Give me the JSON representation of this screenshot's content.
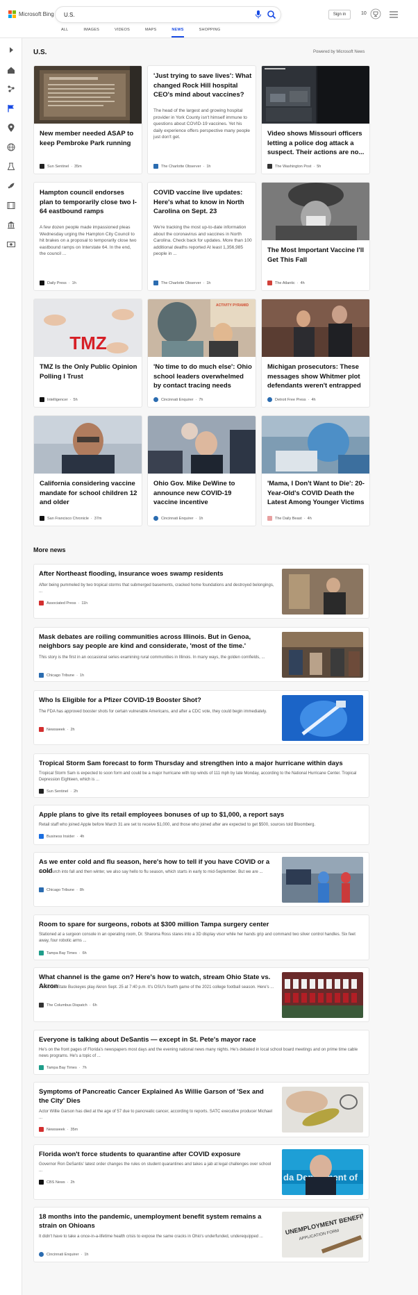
{
  "header": {
    "brand": "Microsoft Bing",
    "search_value": "U.S.",
    "sign_in": "Sign in",
    "rewards_count": "10",
    "tabs": [
      "ALL",
      "IMAGES",
      "VIDEOS",
      "MAPS",
      "NEWS",
      "SHOPPING"
    ],
    "active_tab": "NEWS"
  },
  "colors": {
    "accent": "#174ae4",
    "ms_red": "#f25022",
    "ms_green": "#7fba00",
    "ms_blue": "#00a4ef",
    "ms_yellow": "#ffb900"
  },
  "rail_icons": [
    "expand-icon",
    "home-icon",
    "topics-icon",
    "flag-icon",
    "location-icon",
    "globe-icon",
    "science-icon",
    "rocket-icon",
    "entertainment-icon",
    "building-icon",
    "money-icon"
  ],
  "section": {
    "title": "U.S.",
    "powered_by": "Powered by Microsoft News"
  },
  "cards": [
    {
      "headline": "New member needed ASAP to keep Pembroke Park running",
      "summary": "",
      "source": "Sun Sentinel",
      "time": "35m",
      "has_image": true
    },
    {
      "headline": "'Just trying to save lives': What changed Rock Hill hospital CEO's mind about vaccines?",
      "summary": "The head of the largest and growing hospital provider in York County isn't himself immune to questions about COVID-19 vaccines. Yet his daily experience offers perspective many people just don't get.",
      "source": "The Charlotte Observer",
      "time": "1h",
      "has_image": false
    },
    {
      "headline": "Video shows Missouri officers letting a police dog attack a suspect. Their actions are no...",
      "summary": "",
      "source": "The Washington Post",
      "time": "5h",
      "has_image": true
    },
    {
      "headline": "Hampton council endorses plan to temporarily close two I-64 eastbound ramps",
      "summary": "A few dozen people made impassioned pleas Wednesday urging the Hampton City Council to hit brakes on a proposal to temporarily close two eastbound ramps on Interstate 64. In the end, the council ...",
      "source": "Daily Press",
      "time": "1h",
      "has_image": false
    },
    {
      "headline": "COVID vaccine live updates: Here's what to know in North Carolina on Sept. 23",
      "summary": "We're tracking the most up-to-date information about the coronavirus and vaccines in North Carolina. Check back for updates. More than 100 additional deaths reported At least 1,356,985 people in ...",
      "source": "The Charlotte Observer",
      "time": "1h",
      "has_image": false
    },
    {
      "headline": "The Most Important Vaccine I'll Get This Fall",
      "summary": "",
      "source": "The Atlantic",
      "time": "4h",
      "has_image": true
    },
    {
      "headline": "TMZ Is the Only Public Opinion Polling I Trust",
      "summary": "",
      "source": "Intelligencer",
      "time": "5h",
      "has_image": true,
      "image_text": "TMZ"
    },
    {
      "headline": "'No time to do much else': Ohio school leaders overwhelmed by contact tracing needs",
      "summary": "",
      "source": "Cincinnati Enquirer",
      "time": "7h",
      "has_image": true,
      "image_text": "ACTIVITY PYRAMID"
    },
    {
      "headline": "Michigan prosecutors: These messages show Whitmer plot defendants weren't entrapped",
      "summary": "",
      "source": "Detroit Free Press",
      "time": "4h",
      "has_image": true
    },
    {
      "headline": "California considering vaccine mandate for school children 12 and older",
      "summary": "",
      "source": "San Francisco Chronicle",
      "time": "37m",
      "has_image": true
    },
    {
      "headline": "Ohio Gov. Mike DeWine to announce new COVID-19 vaccine incentive",
      "summary": "",
      "source": "Cincinnati Enquirer",
      "time": "1h",
      "has_image": true
    },
    {
      "headline": "'Mama, I Don't Want to Die': 20-Year-Old's COVID Death the Latest Among Younger Victims",
      "summary": "",
      "source": "The Daily Beast",
      "time": "4h",
      "has_image": true
    }
  ],
  "more_news": {
    "title": "More news",
    "items": [
      {
        "headline": "After Northeast flooding, insurance woes swamp residents",
        "summary": "After being pummeled by two tropical storms that submerged basements, cracked home foundations and destroyed belongings, ...",
        "source": "Associated Press",
        "time": "11h",
        "has_image": true
      },
      {
        "headline": "Mask debates are roiling communities across Illinois. But in Genoa, neighbors say people are kind and considerate, 'most of the time.'",
        "summary": "This story is the first in an occasional series examining rural communities in Illinois. In many ways, the golden cornfields, ...",
        "source": "Chicago Tribune",
        "time": "1h",
        "has_image": true
      },
      {
        "headline": "Who Is Eligible for a Pfizer COVID-19 Booster Shot?",
        "summary": "The FDA has approved booster shots for certain vulnerable Americans, and after a CDC vote, they could begin immediately.",
        "source": "Newsweek",
        "time": "2h",
        "has_image": true
      },
      {
        "headline": "Tropical Storm Sam forecast to form Thursday and strengthen into a major hurricane within days",
        "summary": "Tropical Storm Sam is expected to soon form and could be a major hurricane with top winds of 111 mph by late Monday, according to the National Hurricane Center. Tropical Depression Eighteen, which is ...",
        "source": "Sun Sentinel",
        "time": "2h",
        "has_image": false
      },
      {
        "headline": "Apple plans to give its retail employees bonuses of up to $1,000, a report says",
        "summary": "Retail staff who joined Apple before March 31 are set to receive $1,000, and those who joined after are expected to get $500, sources told Bloomberg.",
        "source": "Business Insider",
        "time": "4h",
        "has_image": false
      },
      {
        "headline": "As we enter cold and flu season, here's how to tell if you have COVID or a cold",
        "summary": "As we lurch into fall and then winter, we also say hello to flu season, which starts in early to mid-September. But we are ...",
        "source": "Chicago Tribune",
        "time": "8h",
        "has_image": true
      },
      {
        "headline": "Room to spare for surgeons, robots at $300 million Tampa surgery center",
        "summary": "Stationed at a surgeon console in an operating room, Dr. Sharona Ross stares into a 3D display visor while her hands grip and command two silver control handles. Six feet away, four robotic arms ...",
        "source": "Tampa Bay Times",
        "time": "6h",
        "has_image": false
      },
      {
        "headline": "What channel is the game on? Here's how to watch, stream Ohio State vs. Akron",
        "summary": "The Ohio State Buckeyes play Akron Sept. 25 at 7:40 p.m. It's OSU's fourth game of the 2021 college football season. Here's ...",
        "source": "The Columbus Dispatch",
        "time": "6h",
        "has_image": true
      },
      {
        "headline": "Everyone is talking about DeSantis — except in St. Pete's mayor race",
        "summary": "He's on the front pages of Florida's newspapers most days and the evening national news many nights. He's debated in local school board meetings and on prime time cable news programs. He's a topic of ...",
        "source": "Tampa Bay Times",
        "time": "7h",
        "has_image": false
      },
      {
        "headline": "Symptoms of Pancreatic Cancer Explained As Willie Garson of 'Sex and the City' Dies",
        "summary": "Actor Willie Garson has died at the age of 57 due to pancreatic cancer, according to reports. SATC executive producer Michael ...",
        "source": "Newsweek",
        "time": "35m",
        "has_image": true
      },
      {
        "headline": "Florida won't force students to quarantine after COVID exposure",
        "summary": "Governor Ron DeSantis' latest order changes the rules on student quarantines and takes a jab at legal challenges over school ...",
        "source": "CBS News",
        "time": "2h",
        "has_image": true,
        "image_text": "da Department of"
      },
      {
        "headline": "18 months into the pandemic, unemployment benefit system remains a strain on Ohioans",
        "summary": "It didn't have to take a once-in-a-lifetime health crisis to expose the same cracks in Ohio's underfunded, underequipped ...",
        "source": "Cincinnati Enquirer",
        "time": "1h",
        "has_image": true,
        "image_text": "UNEMPLOYMENT BENEFITS",
        "image_text_2": "APPLICATION FORM"
      }
    ]
  }
}
